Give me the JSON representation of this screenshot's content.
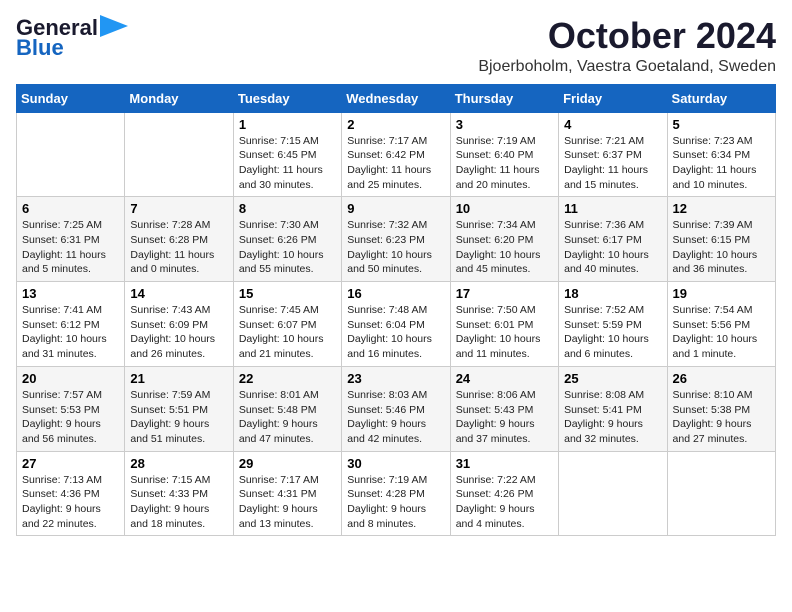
{
  "header": {
    "logo_line1": "General",
    "logo_line2": "Blue",
    "month": "October 2024",
    "location": "Bjoerboholm, Vaestra Goetaland, Sweden"
  },
  "weekdays": [
    "Sunday",
    "Monday",
    "Tuesday",
    "Wednesday",
    "Thursday",
    "Friday",
    "Saturday"
  ],
  "weeks": [
    [
      {
        "day": "",
        "detail": ""
      },
      {
        "day": "",
        "detail": ""
      },
      {
        "day": "1",
        "detail": "Sunrise: 7:15 AM\nSunset: 6:45 PM\nDaylight: 11 hours and 30 minutes."
      },
      {
        "day": "2",
        "detail": "Sunrise: 7:17 AM\nSunset: 6:42 PM\nDaylight: 11 hours and 25 minutes."
      },
      {
        "day": "3",
        "detail": "Sunrise: 7:19 AM\nSunset: 6:40 PM\nDaylight: 11 hours and 20 minutes."
      },
      {
        "day": "4",
        "detail": "Sunrise: 7:21 AM\nSunset: 6:37 PM\nDaylight: 11 hours and 15 minutes."
      },
      {
        "day": "5",
        "detail": "Sunrise: 7:23 AM\nSunset: 6:34 PM\nDaylight: 11 hours and 10 minutes."
      }
    ],
    [
      {
        "day": "6",
        "detail": "Sunrise: 7:25 AM\nSunset: 6:31 PM\nDaylight: 11 hours and 5 minutes."
      },
      {
        "day": "7",
        "detail": "Sunrise: 7:28 AM\nSunset: 6:28 PM\nDaylight: 11 hours and 0 minutes."
      },
      {
        "day": "8",
        "detail": "Sunrise: 7:30 AM\nSunset: 6:26 PM\nDaylight: 10 hours and 55 minutes."
      },
      {
        "day": "9",
        "detail": "Sunrise: 7:32 AM\nSunset: 6:23 PM\nDaylight: 10 hours and 50 minutes."
      },
      {
        "day": "10",
        "detail": "Sunrise: 7:34 AM\nSunset: 6:20 PM\nDaylight: 10 hours and 45 minutes."
      },
      {
        "day": "11",
        "detail": "Sunrise: 7:36 AM\nSunset: 6:17 PM\nDaylight: 10 hours and 40 minutes."
      },
      {
        "day": "12",
        "detail": "Sunrise: 7:39 AM\nSunset: 6:15 PM\nDaylight: 10 hours and 36 minutes."
      }
    ],
    [
      {
        "day": "13",
        "detail": "Sunrise: 7:41 AM\nSunset: 6:12 PM\nDaylight: 10 hours and 31 minutes."
      },
      {
        "day": "14",
        "detail": "Sunrise: 7:43 AM\nSunset: 6:09 PM\nDaylight: 10 hours and 26 minutes."
      },
      {
        "day": "15",
        "detail": "Sunrise: 7:45 AM\nSunset: 6:07 PM\nDaylight: 10 hours and 21 minutes."
      },
      {
        "day": "16",
        "detail": "Sunrise: 7:48 AM\nSunset: 6:04 PM\nDaylight: 10 hours and 16 minutes."
      },
      {
        "day": "17",
        "detail": "Sunrise: 7:50 AM\nSunset: 6:01 PM\nDaylight: 10 hours and 11 minutes."
      },
      {
        "day": "18",
        "detail": "Sunrise: 7:52 AM\nSunset: 5:59 PM\nDaylight: 10 hours and 6 minutes."
      },
      {
        "day": "19",
        "detail": "Sunrise: 7:54 AM\nSunset: 5:56 PM\nDaylight: 10 hours and 1 minute."
      }
    ],
    [
      {
        "day": "20",
        "detail": "Sunrise: 7:57 AM\nSunset: 5:53 PM\nDaylight: 9 hours and 56 minutes."
      },
      {
        "day": "21",
        "detail": "Sunrise: 7:59 AM\nSunset: 5:51 PM\nDaylight: 9 hours and 51 minutes."
      },
      {
        "day": "22",
        "detail": "Sunrise: 8:01 AM\nSunset: 5:48 PM\nDaylight: 9 hours and 47 minutes."
      },
      {
        "day": "23",
        "detail": "Sunrise: 8:03 AM\nSunset: 5:46 PM\nDaylight: 9 hours and 42 minutes."
      },
      {
        "day": "24",
        "detail": "Sunrise: 8:06 AM\nSunset: 5:43 PM\nDaylight: 9 hours and 37 minutes."
      },
      {
        "day": "25",
        "detail": "Sunrise: 8:08 AM\nSunset: 5:41 PM\nDaylight: 9 hours and 32 minutes."
      },
      {
        "day": "26",
        "detail": "Sunrise: 8:10 AM\nSunset: 5:38 PM\nDaylight: 9 hours and 27 minutes."
      }
    ],
    [
      {
        "day": "27",
        "detail": "Sunrise: 7:13 AM\nSunset: 4:36 PM\nDaylight: 9 hours and 22 minutes."
      },
      {
        "day": "28",
        "detail": "Sunrise: 7:15 AM\nSunset: 4:33 PM\nDaylight: 9 hours and 18 minutes."
      },
      {
        "day": "29",
        "detail": "Sunrise: 7:17 AM\nSunset: 4:31 PM\nDaylight: 9 hours and 13 minutes."
      },
      {
        "day": "30",
        "detail": "Sunrise: 7:19 AM\nSunset: 4:28 PM\nDaylight: 9 hours and 8 minutes."
      },
      {
        "day": "31",
        "detail": "Sunrise: 7:22 AM\nSunset: 4:26 PM\nDaylight: 9 hours and 4 minutes."
      },
      {
        "day": "",
        "detail": ""
      },
      {
        "day": "",
        "detail": ""
      }
    ]
  ]
}
